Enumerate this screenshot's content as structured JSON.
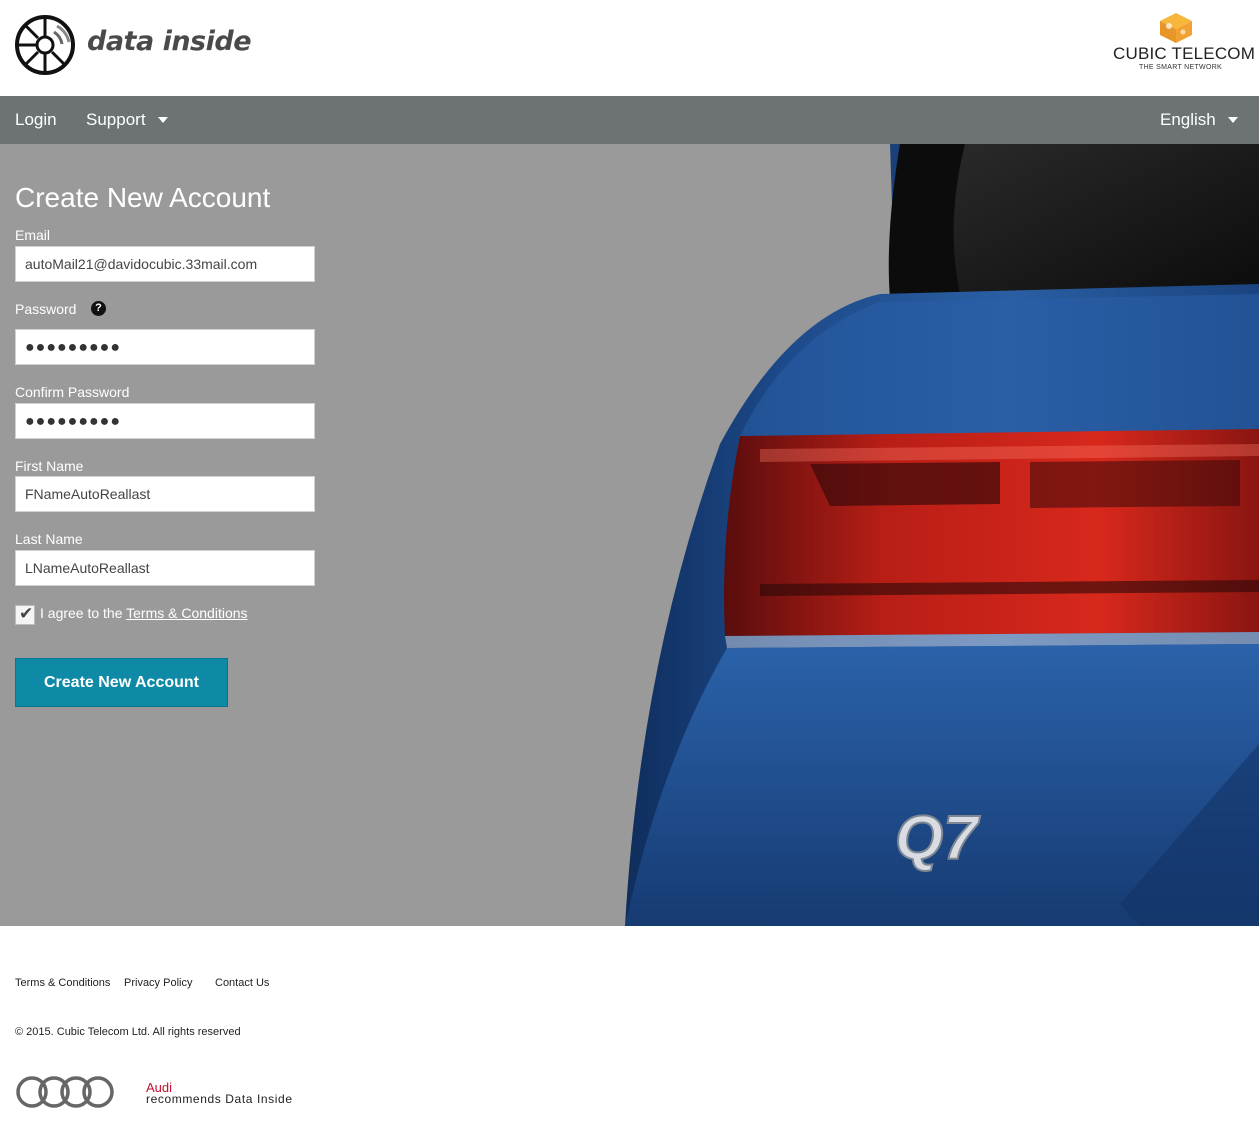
{
  "header": {
    "logo_text": "data inside",
    "partner_logo_text": "CUBIC TELECOM",
    "partner_logo_sub": "THE SMART NETWORK"
  },
  "nav": {
    "login": "Login",
    "support": "Support",
    "language": "English"
  },
  "form": {
    "title": "Create New Account",
    "email_label": "Email",
    "email_value": "autoMail21@davidocubic.33mail.com",
    "password_label": "Password",
    "password_help": "?",
    "password_value": "●●●●●●●●●",
    "confirm_label": "Confirm Password",
    "confirm_value": "●●●●●●●●●",
    "first_name_label": "First Name",
    "first_name_value": "FNameAutoReallast",
    "last_name_label": "Last Name",
    "last_name_value": "LNameAutoReallast",
    "agree_prefix": "I agree to the ",
    "agree_link": "Terms & Conditions",
    "agree_checked": true,
    "submit_label": "Create New Account"
  },
  "hero": {
    "badge_text": "Q7"
  },
  "footer": {
    "links": [
      "Terms & Conditions",
      "Privacy Policy",
      "Contact Us"
    ],
    "copyright": "© 2015. Cubic Telecom Ltd. All rights reserved",
    "audi_brand": "Audi",
    "audi_tagline": "recommends Data Inside"
  },
  "colors": {
    "nav_bg": "#6d7375",
    "hero_bg": "#9a9a9a",
    "button_bg": "#0e8aa6",
    "car_blue": "#1f4f8e",
    "audi_red": "#c0102f"
  }
}
